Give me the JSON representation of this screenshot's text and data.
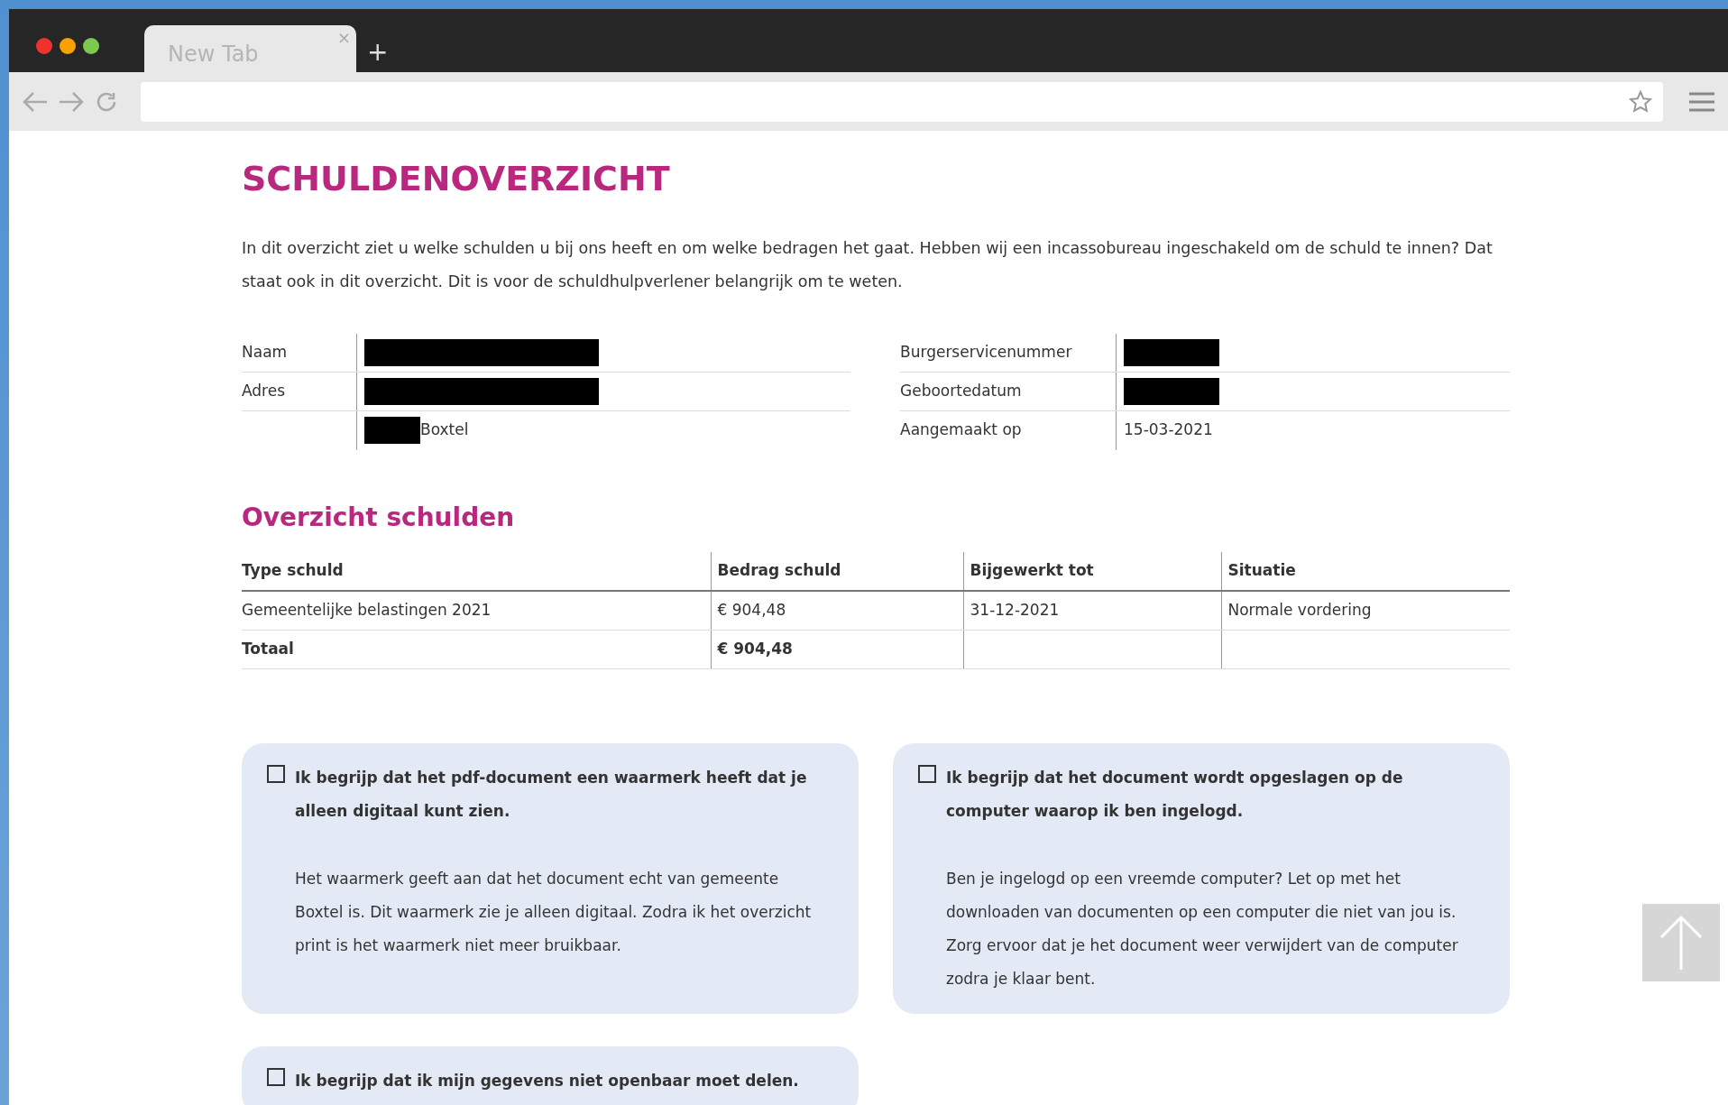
{
  "browser": {
    "tab": {
      "title": "New Tab",
      "selected": true,
      "close": "×"
    },
    "new_tab": "+"
  },
  "page": {
    "title": "SCHULDENOVERZICHT",
    "intro": "In dit overzicht ziet u welke schulden u bij ons heeft en om welke bedragen het gaat. Hebben wij een incassobureau ingeschakeld om de schuld te innen? Dat staat ook in dit overzicht. Dit is voor de schuldhulpverlener belangrijk om te weten.",
    "details_left": [
      {
        "label": "Naam",
        "redacted": true
      },
      {
        "label": "Adres",
        "redacted": true
      },
      {
        "redacted": true,
        "value": "Boxtel"
      }
    ],
    "details_right": [
      {
        "label": "Burgerservicenummer",
        "redacted": true
      },
      {
        "label": "Geboortedatum",
        "redacted": true
      },
      {
        "label": "Aangemaakt op",
        "value": "15-03-2021"
      }
    ],
    "section_title": "Overzicht schulden",
    "table": {
      "columns": [
        "Type schuld",
        "Bedrag schuld",
        "Bijgewerkt tot",
        "Situatie"
      ],
      "rows": [
        {
          "kind": "item",
          "cells": [
            "Gemeentelijke belastingen 2021",
            "€ 904,48",
            "31-12-2021",
            "Normale vordering"
          ]
        },
        {
          "kind": "total",
          "cells": [
            "Totaal",
            "€ 904,48"
          ]
        }
      ]
    },
    "confirmations": [
      {
        "checked": false,
        "label": "Ik begrijp dat het pdf-document een waarmerk heeft dat je alleen digitaal kunt zien.",
        "text": "Het waarmerk geeft aan dat het document echt van gemeente Boxtel is. Dit waarmerk zie je alleen digitaal. Zodra ik het overzicht print is het waarmerk niet meer bruikbaar."
      },
      {
        "checked": false,
        "label": "Ik begrijp dat het document wordt opgeslagen op de computer waarop ik ben ingelogd.",
        "text": "Ben je ingelogd op een vreemde computer? Let op met het downloaden van documenten op een computer die niet van jou is. Zorg ervoor dat je het document weer verwijdert van de computer zodra je klaar bent."
      },
      {
        "checked": false,
        "label": "Ik begrijp dat ik mijn gegevens niet openbaar moet delen."
      }
    ]
  }
}
